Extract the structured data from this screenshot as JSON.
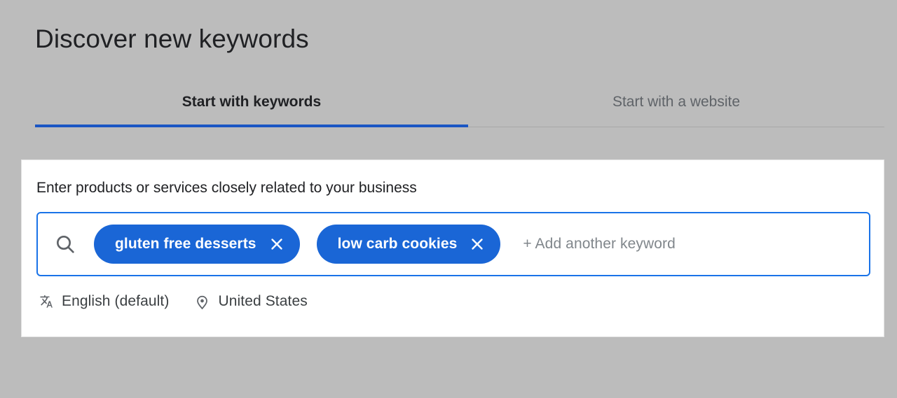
{
  "page": {
    "title": "Discover new keywords",
    "background_color": "#bcbcbc"
  },
  "tabs": {
    "items": [
      {
        "label": "Start with keywords",
        "active": true
      },
      {
        "label": "Start with a website",
        "active": false
      }
    ],
    "active_indicator_color": "#1a56c4"
  },
  "card": {
    "label": "Enter products or services closely related to your business",
    "keyword_input": {
      "search_icon": "search-icon",
      "placeholder": "+ Add another keyword",
      "border_color": "#1a73e8",
      "chip_color": "#1a66d6",
      "chips": [
        {
          "label": "gluten free desserts",
          "remove_icon": "close-icon"
        },
        {
          "label": "low carb cookies",
          "remove_icon": "close-icon"
        }
      ]
    },
    "meta": [
      {
        "icon": "translate-icon",
        "label": "English (default)"
      },
      {
        "icon": "location-pin-icon",
        "label": "United States"
      }
    ]
  }
}
